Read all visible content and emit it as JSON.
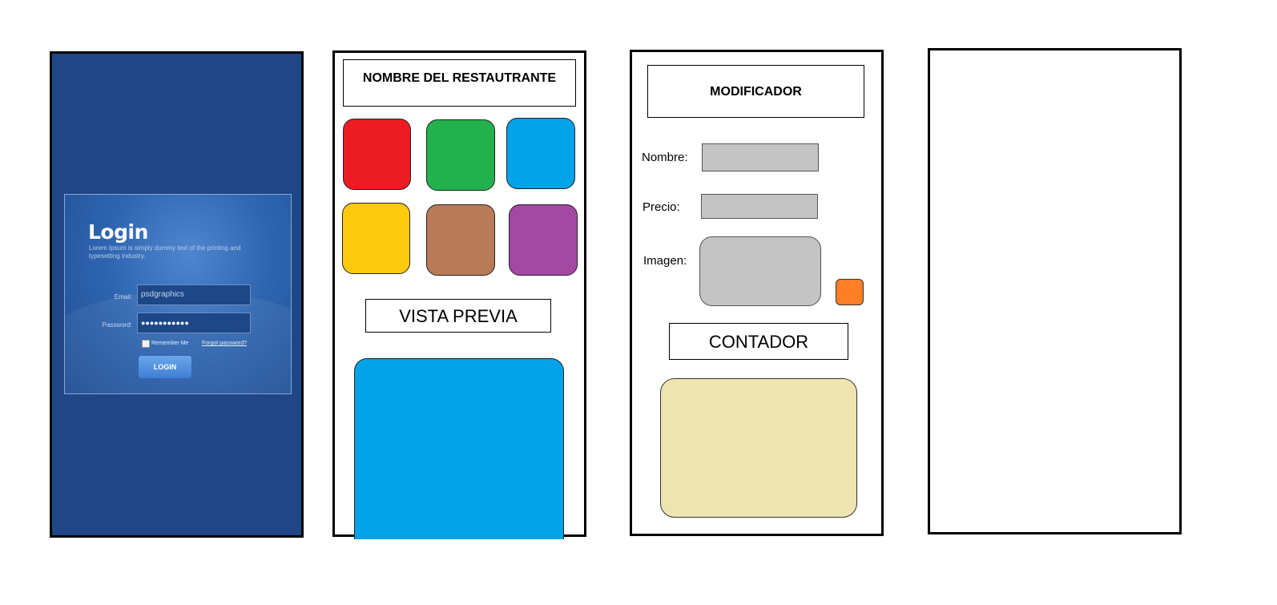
{
  "login_screen": {
    "title": "Login",
    "subtitle": "Lorem Ipsum is simply dummy text of the printing and typesetting industry.",
    "email_label": "Email:",
    "email_value": "psdgraphics",
    "password_label": "Password:",
    "password_value": "●●●●●●●●●●●",
    "remember_label": "Remember Me",
    "forgot_label": "Forgot password?",
    "button_label": "LOGIN"
  },
  "menu_screen": {
    "header": "NOMBRE DEL RESTAUTRANTE",
    "tiles": [
      {
        "color": "#ed1c24"
      },
      {
        "color": "#22b14c"
      },
      {
        "color": "#00a2e8"
      },
      {
        "color": "#ffc90e"
      },
      {
        "color": "#b97a57"
      },
      {
        "color": "#a349a4"
      }
    ],
    "preview_label": "VISTA PREVIA",
    "preview_color": "#00a2e8"
  },
  "editor_screen": {
    "header": "MODIFICADOR",
    "name_label": "Nombre:",
    "price_label": "Precio:",
    "image_label": "Imagen:",
    "input_color": "#c4c4c4",
    "image_button_color": "#ff7f27",
    "counter_label": "CONTADOR",
    "counter_color": "#efe4b0"
  }
}
